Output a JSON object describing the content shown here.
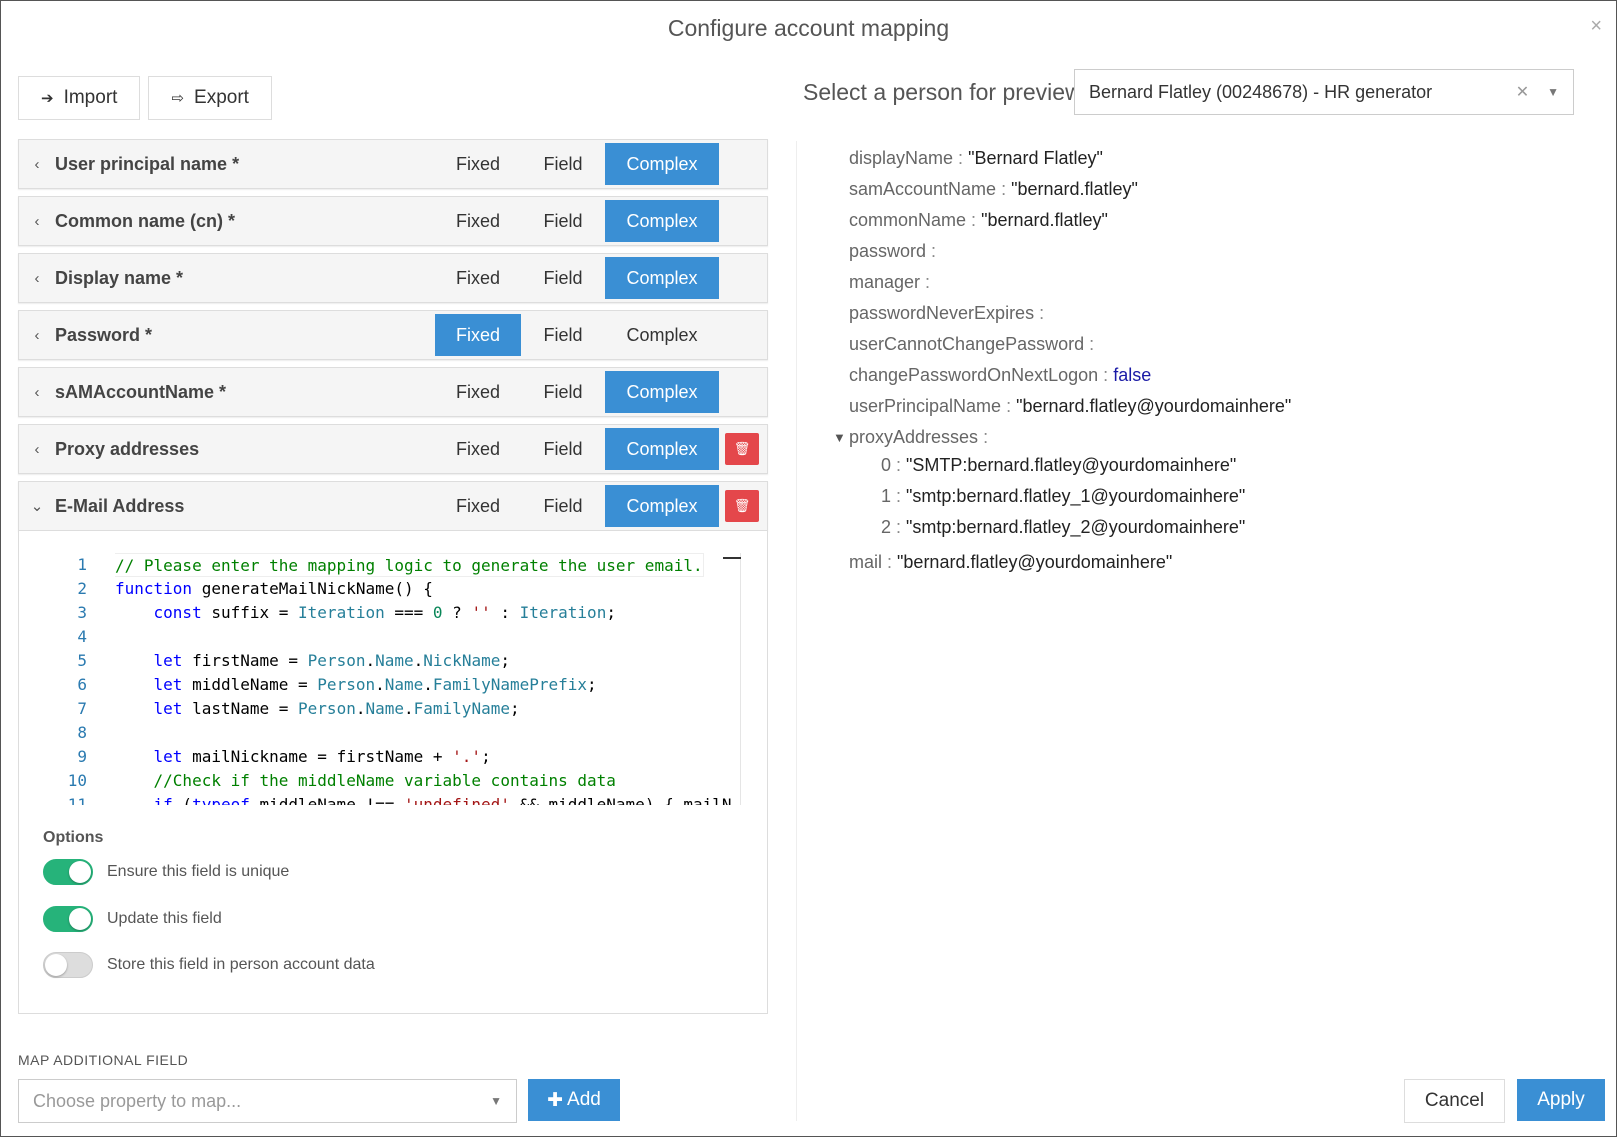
{
  "dialog": {
    "title": "Configure account mapping",
    "close": "×"
  },
  "toolbar": {
    "import_label": "Import",
    "export_label": "Export",
    "import_icon": "sign-in-icon",
    "export_icon": "share-icon"
  },
  "segments": {
    "fixed": "Fixed",
    "field": "Field",
    "complex": "Complex"
  },
  "rows": [
    {
      "label": "User principal name *",
      "active": "complex",
      "deletable": false,
      "expanded": false
    },
    {
      "label": "Common name (cn) *",
      "active": "complex",
      "deletable": false,
      "expanded": false
    },
    {
      "label": "Display name *",
      "active": "complex",
      "deletable": false,
      "expanded": false
    },
    {
      "label": "Password *",
      "active": "fixed",
      "deletable": false,
      "expanded": false
    },
    {
      "label": "sAMAccountName *",
      "active": "complex",
      "deletable": false,
      "expanded": false
    },
    {
      "label": "Proxy addresses",
      "active": "complex",
      "deletable": true,
      "expanded": false
    },
    {
      "label": "E-Mail Address",
      "active": "complex",
      "deletable": true,
      "expanded": true
    }
  ],
  "code_editor": {
    "lines": [
      "// Please enter the mapping logic to generate the user email.",
      "function generateMailNickName() {",
      "    const suffix = Iteration === 0 ? '' : Iteration;",
      "",
      "    let firstName = Person.Name.NickName;",
      "    let middleName = Person.Name.FamilyNamePrefix;",
      "    let lastName = Person.Name.FamilyName;",
      "",
      "    let mailNickname = firstName + '.';",
      "    //Check if the middleName variable contains data",
      "    if (typeof middleName !== 'undefined' && middleName) { mailN"
    ]
  },
  "options": {
    "title": "Options",
    "items": [
      {
        "label": "Ensure this field is unique",
        "on": true
      },
      {
        "label": "Update this field",
        "on": true
      },
      {
        "label": "Store this field in person account data",
        "on": false
      }
    ]
  },
  "map_additional": {
    "title": "MAP ADDITIONAL FIELD",
    "placeholder": "Choose property to map...",
    "add_label": "Add"
  },
  "preview": {
    "label": "Select a person for preview",
    "selected": "Bernard Flatley (00248678) - HR generator",
    "properties": [
      {
        "key": "displayName",
        "value": "\"Bernard Flatley\""
      },
      {
        "key": "samAccountName",
        "value": "\"bernard.flatley\""
      },
      {
        "key": "commonName",
        "value": "\"bernard.flatley\""
      },
      {
        "key": "password",
        "value": ""
      },
      {
        "key": "manager",
        "value": ""
      },
      {
        "key": "passwordNeverExpires",
        "value": ""
      },
      {
        "key": "userCannotChangePassword",
        "value": ""
      },
      {
        "key": "changePasswordOnNextLogon",
        "value": "false",
        "bool": true
      },
      {
        "key": "userPrincipalName",
        "value": "\"bernard.flatley@yourdomainhere\""
      }
    ],
    "proxy": {
      "key": "proxyAddresses",
      "items": [
        {
          "idx": "0",
          "value": "\"SMTP:bernard.flatley@yourdomainhere\""
        },
        {
          "idx": "1",
          "value": "\"smtp:bernard.flatley_1@yourdomainhere\""
        },
        {
          "idx": "2",
          "value": "\"smtp:bernard.flatley_2@yourdomainhere\""
        }
      ]
    },
    "mail": {
      "key": "mail",
      "value": "\"bernard.flatley@yourdomainhere\""
    }
  },
  "footer": {
    "cancel_label": "Cancel",
    "apply_label": "Apply"
  },
  "colors": {
    "primary": "#3a8fd4",
    "danger": "#e4474b",
    "toggle_on": "#26b37a"
  }
}
